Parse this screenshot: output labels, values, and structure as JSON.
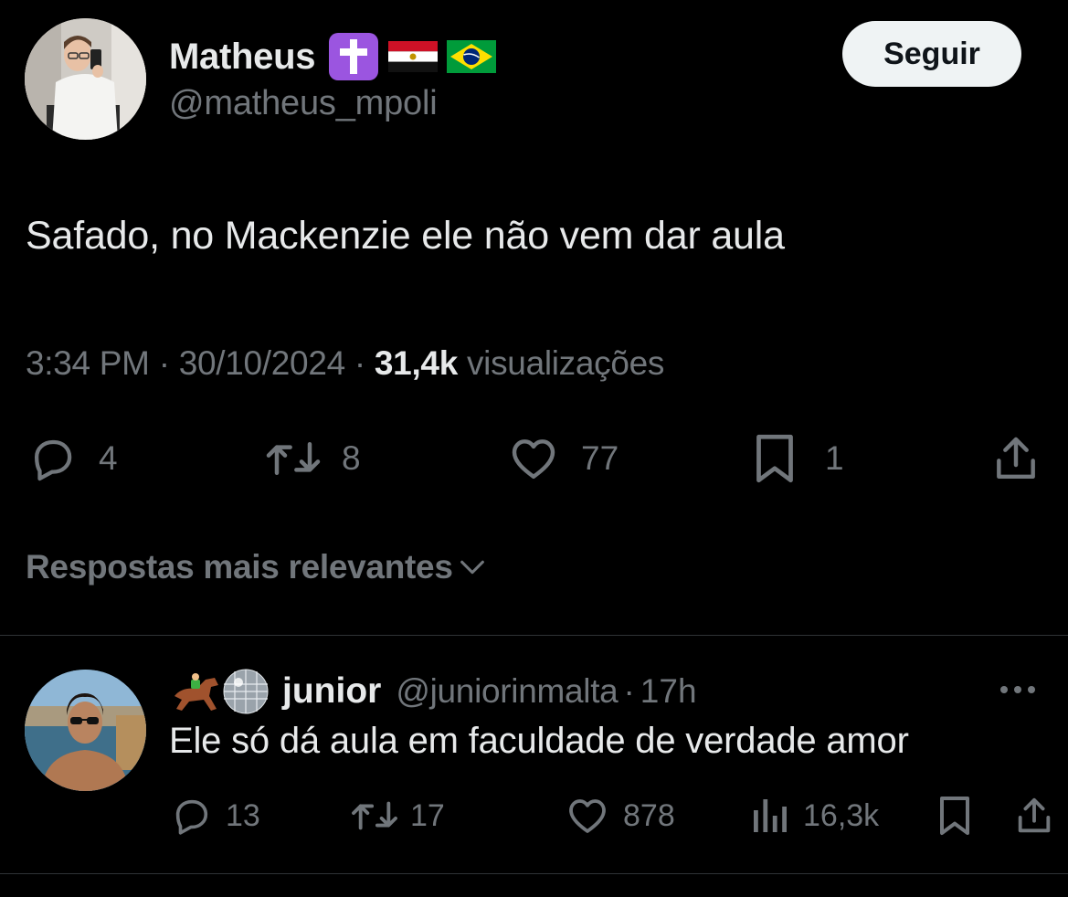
{
  "tweet": {
    "author": {
      "display_name": "Matheus",
      "handle": "@matheus_mpoli",
      "badges": [
        "latin-cross-emoji",
        "egypt-flag-emoji",
        "brazil-flag-emoji"
      ]
    },
    "follow_label": "Seguir",
    "text": "Safado, no Mackenzie ele não vem dar aula",
    "meta": {
      "time": "3:34 PM",
      "separator": "·",
      "date": "30/10/2024",
      "views_count": "31,4k",
      "views_label": "visualizações"
    },
    "stats": {
      "replies": "4",
      "reposts": "8",
      "likes": "77",
      "bookmarks": "1"
    }
  },
  "replies_sort": {
    "label": "Respostas mais relevantes"
  },
  "reply": {
    "name_emojis": [
      "horse-racing-emoji",
      "mirror-ball-emoji"
    ],
    "display_name": "junior",
    "handle": "@juniorinmalta",
    "separator": "·",
    "time": "17h",
    "text": "Ele só dá aula em faculdade de verdade amor",
    "stats": {
      "replies": "13",
      "reposts": "17",
      "likes": "878",
      "views": "16,3k"
    }
  },
  "colors": {
    "background": "#000000",
    "text_primary": "#e7e9ea",
    "text_secondary": "#71767b",
    "divider": "#2f3336",
    "follow_button_bg": "#eff3f4"
  }
}
